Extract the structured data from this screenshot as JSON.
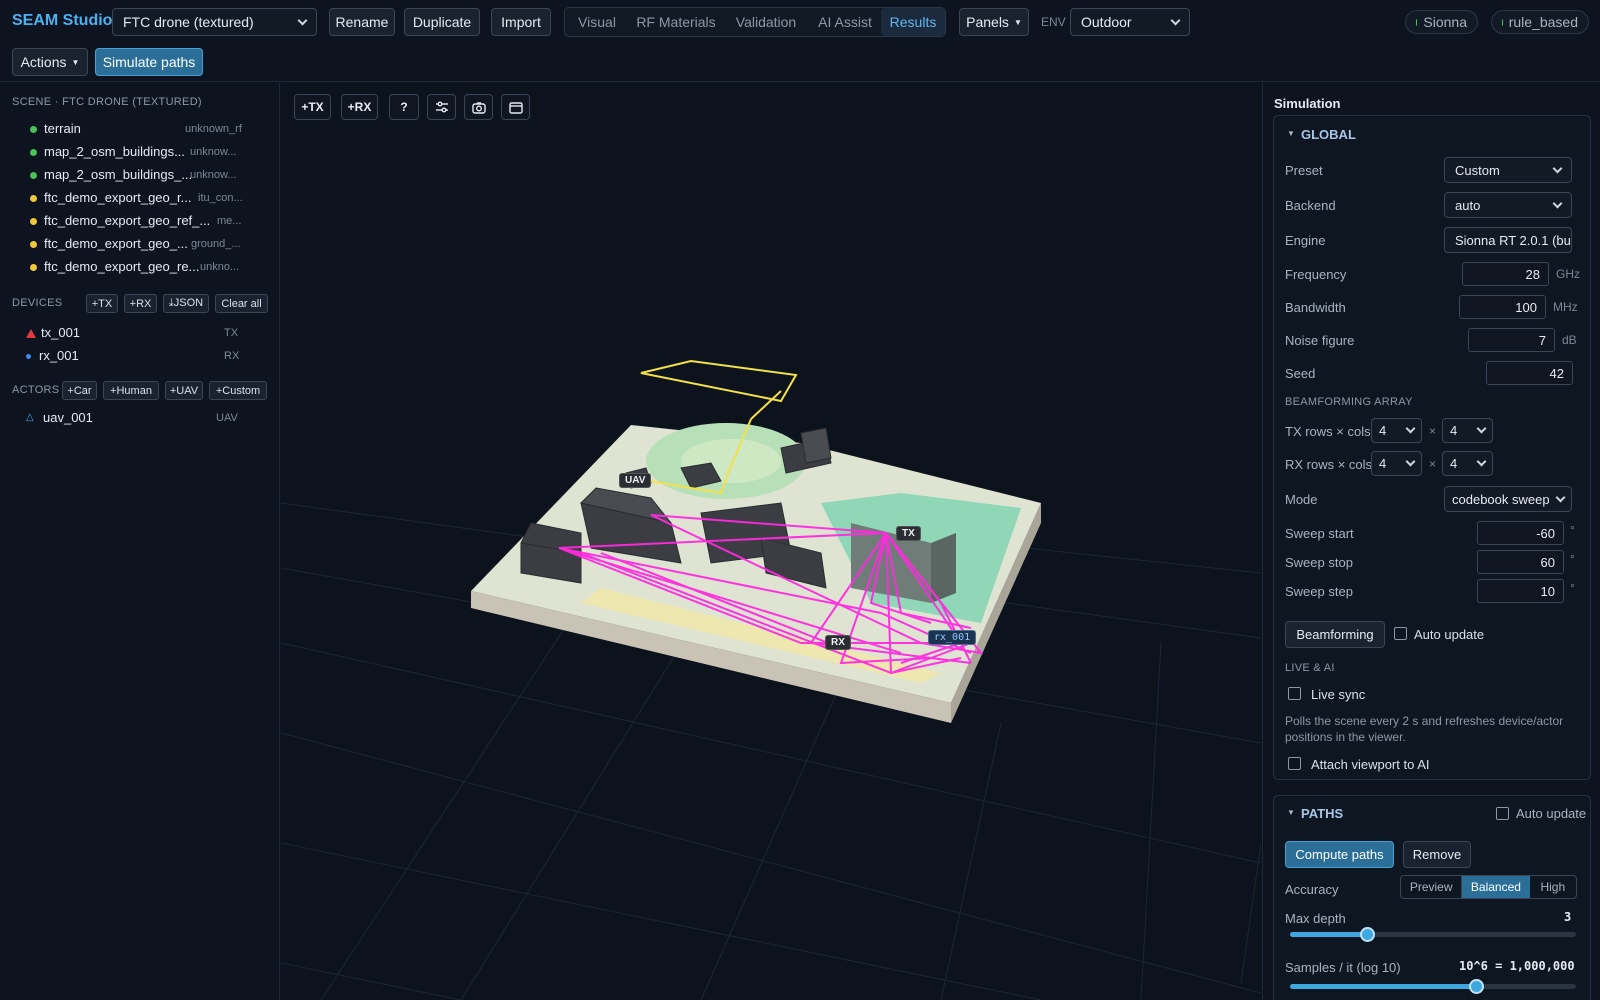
{
  "app": {
    "title": "SEAM Studio"
  },
  "topbar": {
    "scene_select": "FTC drone (textured)",
    "rename": "Rename",
    "duplicate": "Duplicate",
    "import": "Import",
    "tabs": [
      "Visual",
      "RF Materials",
      "Validation",
      "AI Assist",
      "Results"
    ],
    "active_tab": "Results",
    "panels": "Panels",
    "env_label": "ENV",
    "env_select": "Outdoor",
    "status": [
      "Sionna",
      "rule_based"
    ]
  },
  "toolbar2": {
    "actions": "Actions",
    "simulate_paths": "Simulate paths"
  },
  "sidebar": {
    "scene_header": "SCENE · FTC DRONE (TEXTURED)",
    "scene_items": [
      {
        "name": "terrain",
        "material": "unknown_rf",
        "status": "green"
      },
      {
        "name": "map_2_osm_buildings...",
        "material": "unknow...",
        "status": "green"
      },
      {
        "name": "map_2_osm_buildings_...",
        "material": "unknow...",
        "status": "green"
      },
      {
        "name": "ftc_demo_export_geo_r...",
        "material": "itu_con...",
        "status": "yellow"
      },
      {
        "name": "ftc_demo_export_geo_ref_...",
        "material": "me...",
        "status": "yellow"
      },
      {
        "name": "ftc_demo_export_geo_...",
        "material": "ground_...",
        "status": "yellow"
      },
      {
        "name": "ftc_demo_export_geo_re...",
        "material": "unkno...",
        "status": "yellow"
      }
    ],
    "devices_header": "DEVICES",
    "device_buttons": [
      "+TX",
      "+RX",
      "⤓JSON",
      "Clear all"
    ],
    "devices": [
      {
        "name": "tx_001",
        "type": "TX",
        "icon": "triangle-red"
      },
      {
        "name": "rx_001",
        "type": "RX",
        "icon": "dot-blue"
      }
    ],
    "actors_header": "ACTORS",
    "actor_buttons": [
      "+Car",
      "+Human",
      "+UAV",
      "+Custom"
    ],
    "actors": [
      {
        "name": "uav_001",
        "type": "UAV",
        "icon": "triangle-outline"
      }
    ]
  },
  "viewport": {
    "tools": [
      "+TX",
      "+RX",
      "?",
      "sliders-icon",
      "camera-icon",
      "calendar-icon"
    ],
    "labels": {
      "uav": "UAV",
      "tx": "TX",
      "rx": "RX",
      "rx_device": "rx_001"
    }
  },
  "simulation": {
    "title": "Simulation",
    "global": {
      "header": "GLOBAL",
      "preset_label": "Preset",
      "preset": "Custom",
      "backend_label": "Backend",
      "backend": "auto",
      "engine_label": "Engine",
      "engine": "Sionna RT 2.0.1 (bu",
      "frequency_label": "Frequency",
      "frequency": "28",
      "frequency_unit": "GHz",
      "bandwidth_label": "Bandwidth",
      "bandwidth": "100",
      "bandwidth_unit": "MHz",
      "noise_label": "Noise figure",
      "noise": "7",
      "noise_unit": "dB",
      "seed_label": "Seed",
      "seed": "42",
      "beam_header": "BEAMFORMING ARRAY",
      "tx_rc_label": "TX rows × cols",
      "tx_rows": "4",
      "tx_cols": "4",
      "rx_rc_label": "RX rows × cols",
      "rx_rows": "4",
      "rx_cols": "4",
      "times": "×",
      "mode_label": "Mode",
      "mode": "codebook sweep",
      "sweep_start_label": "Sweep start",
      "sweep_start": "-60",
      "sweep_stop_label": "Sweep stop",
      "sweep_stop": "60",
      "sweep_step_label": "Sweep step",
      "sweep_step": "10",
      "deg": "°",
      "beamforming_button": "Beamforming",
      "auto_update": "Auto update",
      "live_header": "LIVE & AI",
      "live_sync": "Live sync",
      "live_desc": "Polls the scene every 2 s and refreshes device/actor positions in the viewer.",
      "attach_viewport": "Attach viewport to AI"
    },
    "paths": {
      "header": "PATHS",
      "auto_update": "Auto update",
      "compute": "Compute paths",
      "remove": "Remove",
      "accuracy_label": "Accuracy",
      "accuracy_options": [
        "Preview",
        "Balanced",
        "High"
      ],
      "accuracy_selected": "Balanced",
      "max_depth_label": "Max depth",
      "max_depth": "3",
      "max_depth_fraction": 0.27,
      "samples_label": "Samples / it (log 10)",
      "samples": "10^6 = 1,000,000",
      "samples_fraction": 0.65
    }
  }
}
